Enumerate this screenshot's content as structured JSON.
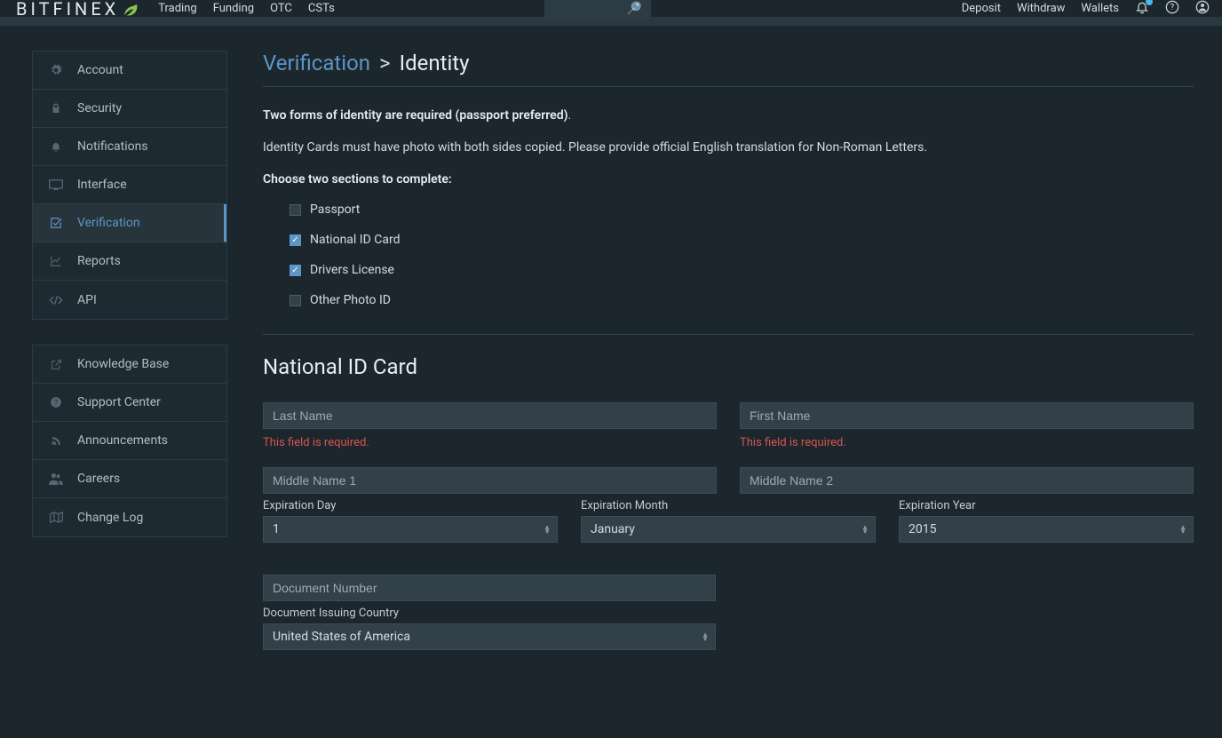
{
  "brand": "BITFINEX",
  "nav": {
    "trading": "Trading",
    "funding": "Funding",
    "otc": "OTC",
    "csts": "CSTs"
  },
  "right_nav": {
    "deposit": "Deposit",
    "withdraw": "Withdraw",
    "wallets": "Wallets"
  },
  "sidebar": {
    "main": {
      "account": "Account",
      "security": "Security",
      "notifications": "Notifications",
      "interface": "Interface",
      "verification": "Verification",
      "reports": "Reports",
      "api": "API"
    },
    "help": {
      "knowledge_base": "Knowledge Base",
      "support_center": "Support Center",
      "announcements": "Announcements",
      "careers": "Careers",
      "change_log": "Change Log"
    }
  },
  "title": {
    "link": "Verification",
    "sep": ">",
    "current": "Identity"
  },
  "info": {
    "line1_strong": "Two forms of identity are required (passport preferred)",
    "line1_tail": ".",
    "line2": "Identity Cards must have photo with both sides copied. Please provide official English translation for Non-Roman Letters.",
    "choose_label": "Choose two sections to complete:"
  },
  "checklist": {
    "passport": {
      "label": "Passport",
      "checked": false
    },
    "national_id": {
      "label": "National ID Card",
      "checked": true
    },
    "drivers_license": {
      "label": "Drivers License",
      "checked": true
    },
    "other": {
      "label": "Other Photo ID",
      "checked": false
    }
  },
  "form": {
    "heading": "National ID Card",
    "last_name": {
      "placeholder": "Last Name",
      "error": "This field is required."
    },
    "first_name": {
      "placeholder": "First Name",
      "error": "This field is required."
    },
    "middle1": {
      "placeholder": "Middle Name 1"
    },
    "middle2": {
      "placeholder": "Middle Name 2"
    },
    "exp_day": {
      "label": "Expiration Day",
      "value": "1"
    },
    "exp_month": {
      "label": "Expiration Month",
      "value": "January"
    },
    "exp_year": {
      "label": "Expiration Year",
      "value": "2015"
    },
    "doc_number": {
      "placeholder": "Document Number"
    },
    "issuing_country": {
      "label": "Document Issuing Country",
      "value": "United States of America"
    }
  }
}
